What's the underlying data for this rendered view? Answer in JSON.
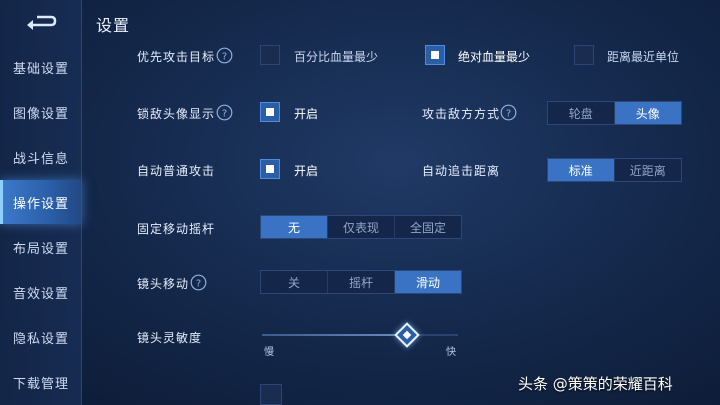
{
  "title": "设置",
  "sidebar": {
    "items": [
      {
        "label": "基础设置"
      },
      {
        "label": "图像设置"
      },
      {
        "label": "战斗信息"
      },
      {
        "label": "操作设置"
      },
      {
        "label": "布局设置"
      },
      {
        "label": "音效设置"
      },
      {
        "label": "隐私设置"
      },
      {
        "label": "下载管理"
      }
    ],
    "active": "操作设置"
  },
  "settings": {
    "priority_target": {
      "label": "优先攻击目标",
      "options": [
        {
          "label": "百分比血量最少",
          "checked": false
        },
        {
          "label": "绝对血量最少",
          "checked": true
        },
        {
          "label": "距离最近单位",
          "checked": false
        }
      ]
    },
    "lock_avatar": {
      "label": "锁敌头像显示",
      "option": "开启",
      "checked": true
    },
    "attack_mode": {
      "label": "攻击敌方方式",
      "options": [
        "轮盘",
        "头像"
      ],
      "selected": "头像"
    },
    "auto_attack": {
      "label": "自动普通攻击",
      "option": "开启",
      "checked": true
    },
    "chase_distance": {
      "label": "自动追击距离",
      "options": [
        "标准",
        "近距离"
      ],
      "selected": "标准"
    },
    "fixed_joystick": {
      "label": "固定移动摇杆",
      "options": [
        "无",
        "仅表现",
        "全固定"
      ],
      "selected": "无"
    },
    "camera_move": {
      "label": "镜头移动",
      "options": [
        "关",
        "摇杆",
        "滑动"
      ],
      "selected": "滑动"
    },
    "camera_sensitivity": {
      "label": "镜头灵敏度",
      "min_label": "慢",
      "max_label": "快",
      "value": 0.75
    }
  },
  "watermark": "头条 @策策的荣耀百科",
  "colors": {
    "accent": "#3a73c3",
    "background": "#152a4e"
  },
  "icons": {
    "back": "back-arrow-icon",
    "help": "help-icon"
  }
}
